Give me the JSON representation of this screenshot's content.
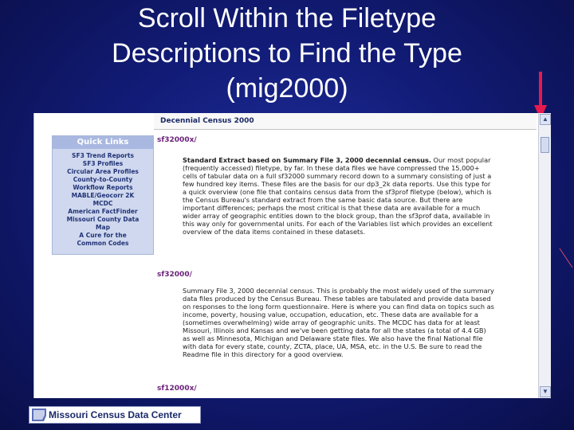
{
  "slide": {
    "title_lines": [
      "Scroll Within the Filetype",
      "Descriptions to Find the Type",
      "(mig2000)"
    ]
  },
  "colors": {
    "arrow": "#e8194f",
    "background": "#121c78"
  },
  "icons": {
    "arrow": "down-arrow-icon",
    "logo": "missouri-census-logo-icon"
  },
  "page": {
    "header": "Decennial Census 2000",
    "quick_links": {
      "title": "Quick Links",
      "items": [
        "SF3 Trend Reports",
        "SF3 Profiles",
        "Circular Area Profiles",
        "County-to-County",
        "Workflow Reports",
        "MABLE/Geocorr 2K",
        "MCDC",
        "American FactFinder",
        "Missouri County Data",
        "Map",
        "A Cure for the",
        "Common Codes"
      ]
    },
    "entries": [
      {
        "dir": "sf32000x/",
        "heading": "Standard Extract based on Summary File 3, 2000 decennial census.",
        "text": " Our most popular (frequently accessed) filetype, by far. In these data files we have compressed the 15,000+ cells of tabular data on a full sf32000 summary record down to a summary consisting of just a few hundred key items. These files are the basis for our dp3_2k data reports. Use this type for a quick overview (one file that contains census data from the sf3prof filetype (below), which is the Census Bureau's standard extract from the same basic data source. But there are important differences; perhaps the most critical is that these data are available for a much wider array of geographic entities down to the block group, than the sf3prof data, available in this way only for governmental units. For each of the Variables list which provides an excellent overview of the data items contained in these datasets."
      },
      {
        "dir": "sf32000/",
        "text": "Summary File 3, 2000 decennial census. This is probably the most widely used of the summary data files produced by the Census Bureau. These tables are tabulated and provide data based on responses to the long form questionnaire. Here is where you can find data on topics such as income, poverty, housing value, occupation, education, etc. These data are available for a (sometimes overwhelming) wide array of geographic units. The MCDC has data for at least Missouri, Illinois and Kansas and we've been getting data for all the states (a total of 4.4 GB) as well as Minnesota, Michigan and Delaware state files. We also have the final National file with data for every state, county, ZCTA, place, UA, MSA, etc. in the U.S. Be sure to read the Readme file in this directory for a good overview."
      },
      {
        "dir": "sf12000x/"
      }
    ]
  },
  "footer": {
    "logo_text": "Missouri Census Data Center"
  }
}
